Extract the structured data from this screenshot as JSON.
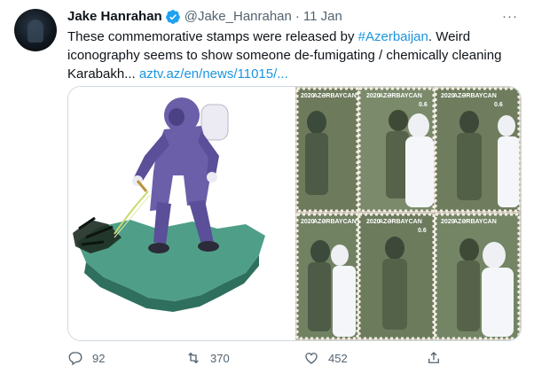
{
  "tweet": {
    "author_name": "Jake Hanrahan",
    "author_handle": "@Jake_Hanrahan",
    "separator": "·",
    "date": "11 Jan",
    "more_label": "···",
    "text_before": "These commemorative stamps were released by ",
    "hashtag": "#Azerbaijan",
    "text_after": ". Weird iconography seems to show someone de-fumigating / chemically cleaning Karabakh... ",
    "link": "aztv.az/en/news/11015/...",
    "stamp_year": "2020",
    "stamp_country": "AZƏRBAYCAN",
    "stamp_value": "0.6"
  },
  "actions": {
    "replies": "92",
    "retweets": "370",
    "likes": "452"
  },
  "colors": {
    "link": "#1b95e0",
    "muted": "#536471",
    "verified": "#1da1f2",
    "suit": "#6a5fa8",
    "map": "#4f9f88"
  },
  "icons": [
    "verified-badge-icon",
    "more-icon",
    "reply-icon",
    "retweet-icon",
    "like-icon",
    "share-icon"
  ]
}
